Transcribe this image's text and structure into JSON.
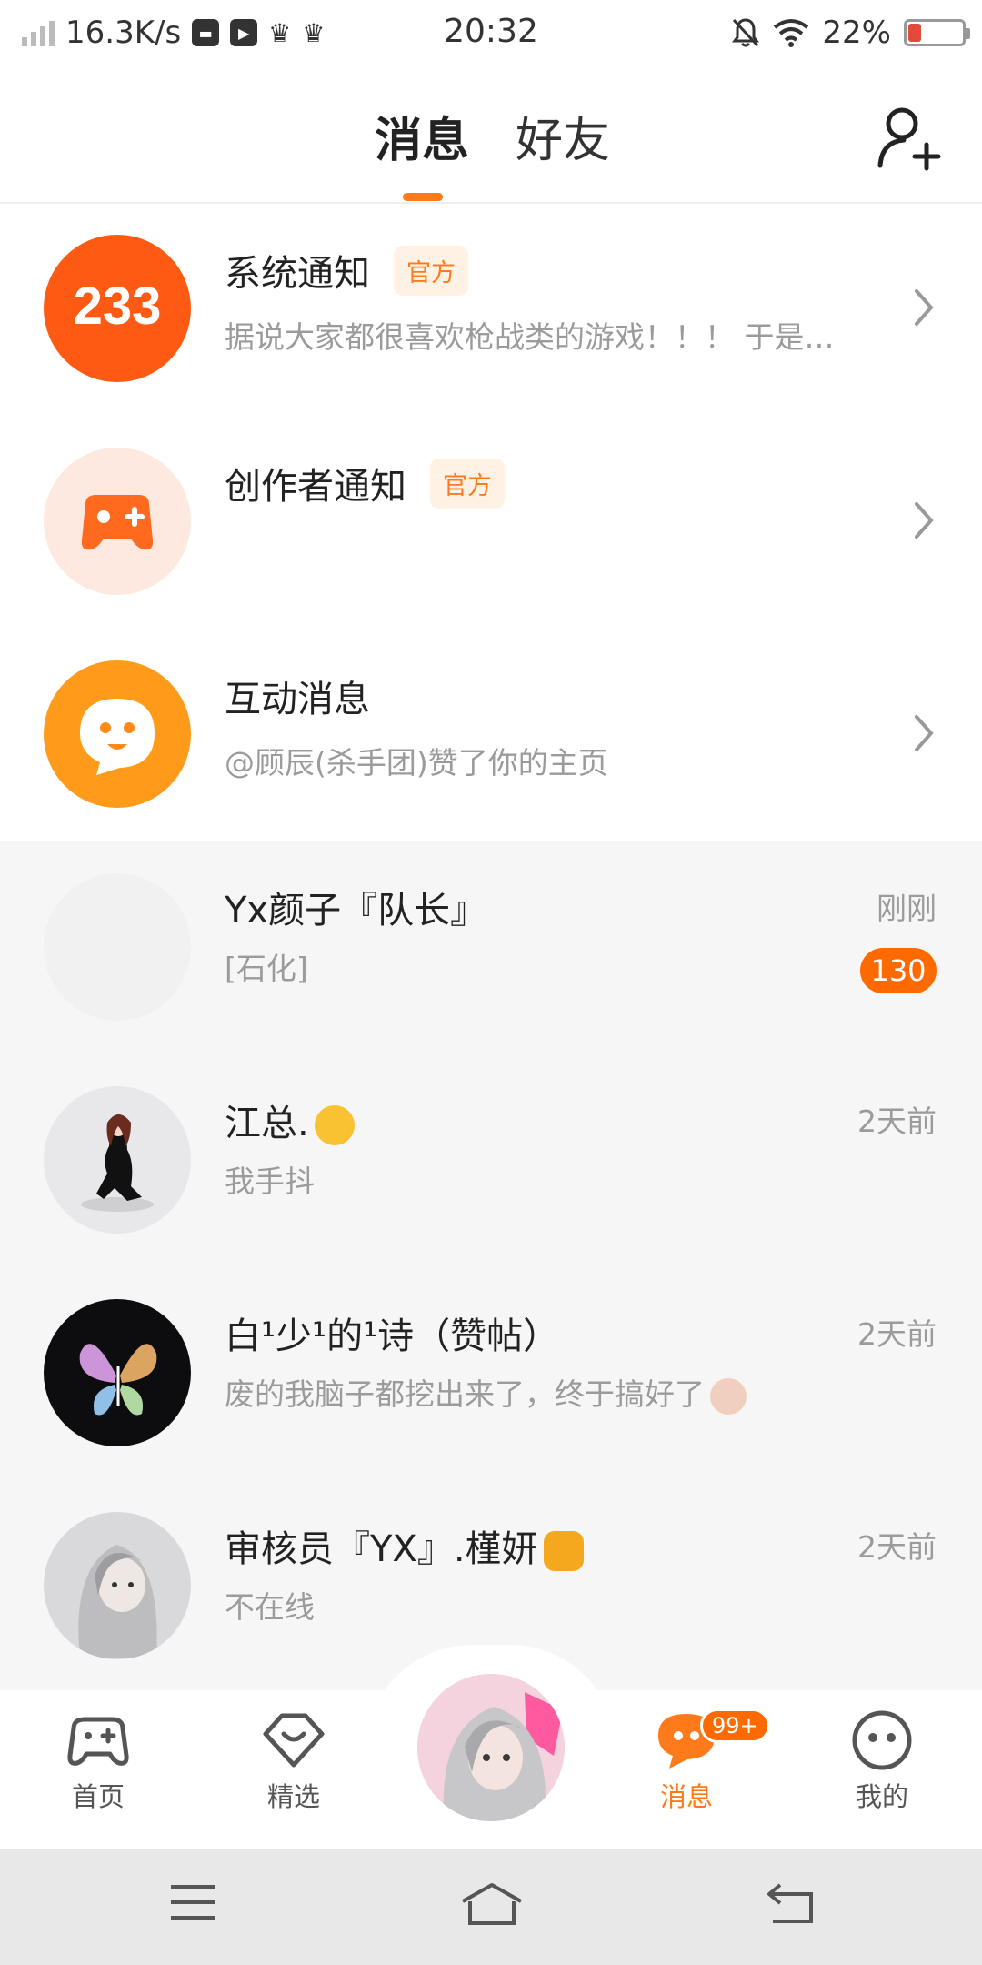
{
  "status_bar": {
    "net_speed": "16.3K/s",
    "time": "20:32",
    "battery": "22%",
    "battery_level": 0.22,
    "icons": [
      "signal-icon",
      "message-app-icon",
      "video-app-icon",
      "crown-icon",
      "crown-icon",
      "mute-icon",
      "wifi-icon",
      "battery-icon"
    ]
  },
  "header": {
    "tabs": [
      {
        "label": "消息",
        "active": true
      },
      {
        "label": "好友",
        "active": false
      }
    ],
    "add_friend_icon": "add-friend-icon",
    "accent": "#ff7a1a"
  },
  "official": [
    {
      "title": "系统通知",
      "badge": "官方",
      "preview": "据说大家都很喜欢枪战类的游戏！！！ 于是…",
      "icon": "233-logo"
    },
    {
      "title": "创作者通知",
      "badge": "官方",
      "preview": "",
      "icon": "gamepad-icon"
    },
    {
      "title": "互动消息",
      "badge": "",
      "preview": "@顾辰(杀手团)赞了你的主页",
      "icon": "chat-face-icon"
    }
  ],
  "chats": [
    {
      "name": "Yx颜子『队长』",
      "message": "[石化]",
      "time": "刚刚",
      "unread": "130"
    },
    {
      "name": "江总.",
      "message": "我手抖",
      "time": "2天前",
      "unread": ""
    },
    {
      "name": "白¹少¹的¹诗（赞帖）",
      "message": "废的我脑子都挖出来了，终于搞好了",
      "time": "2天前",
      "unread": ""
    },
    {
      "name": "审核员『YX』.槿妍",
      "message": "不在线",
      "time": "2天前",
      "unread": ""
    }
  ],
  "bottom_nav": {
    "items": [
      {
        "label": "首页",
        "icon": "gamepad-icon",
        "active": false
      },
      {
        "label": "精选",
        "icon": "heart-chat-icon",
        "active": false
      },
      {
        "label": "消息",
        "icon": "message-icon",
        "active": true
      },
      {
        "label": "我的",
        "icon": "face-icon",
        "active": false
      }
    ],
    "message_badge": "99+"
  },
  "system_nav": {
    "icons": [
      "menu-icon",
      "home-icon",
      "back-icon"
    ]
  }
}
